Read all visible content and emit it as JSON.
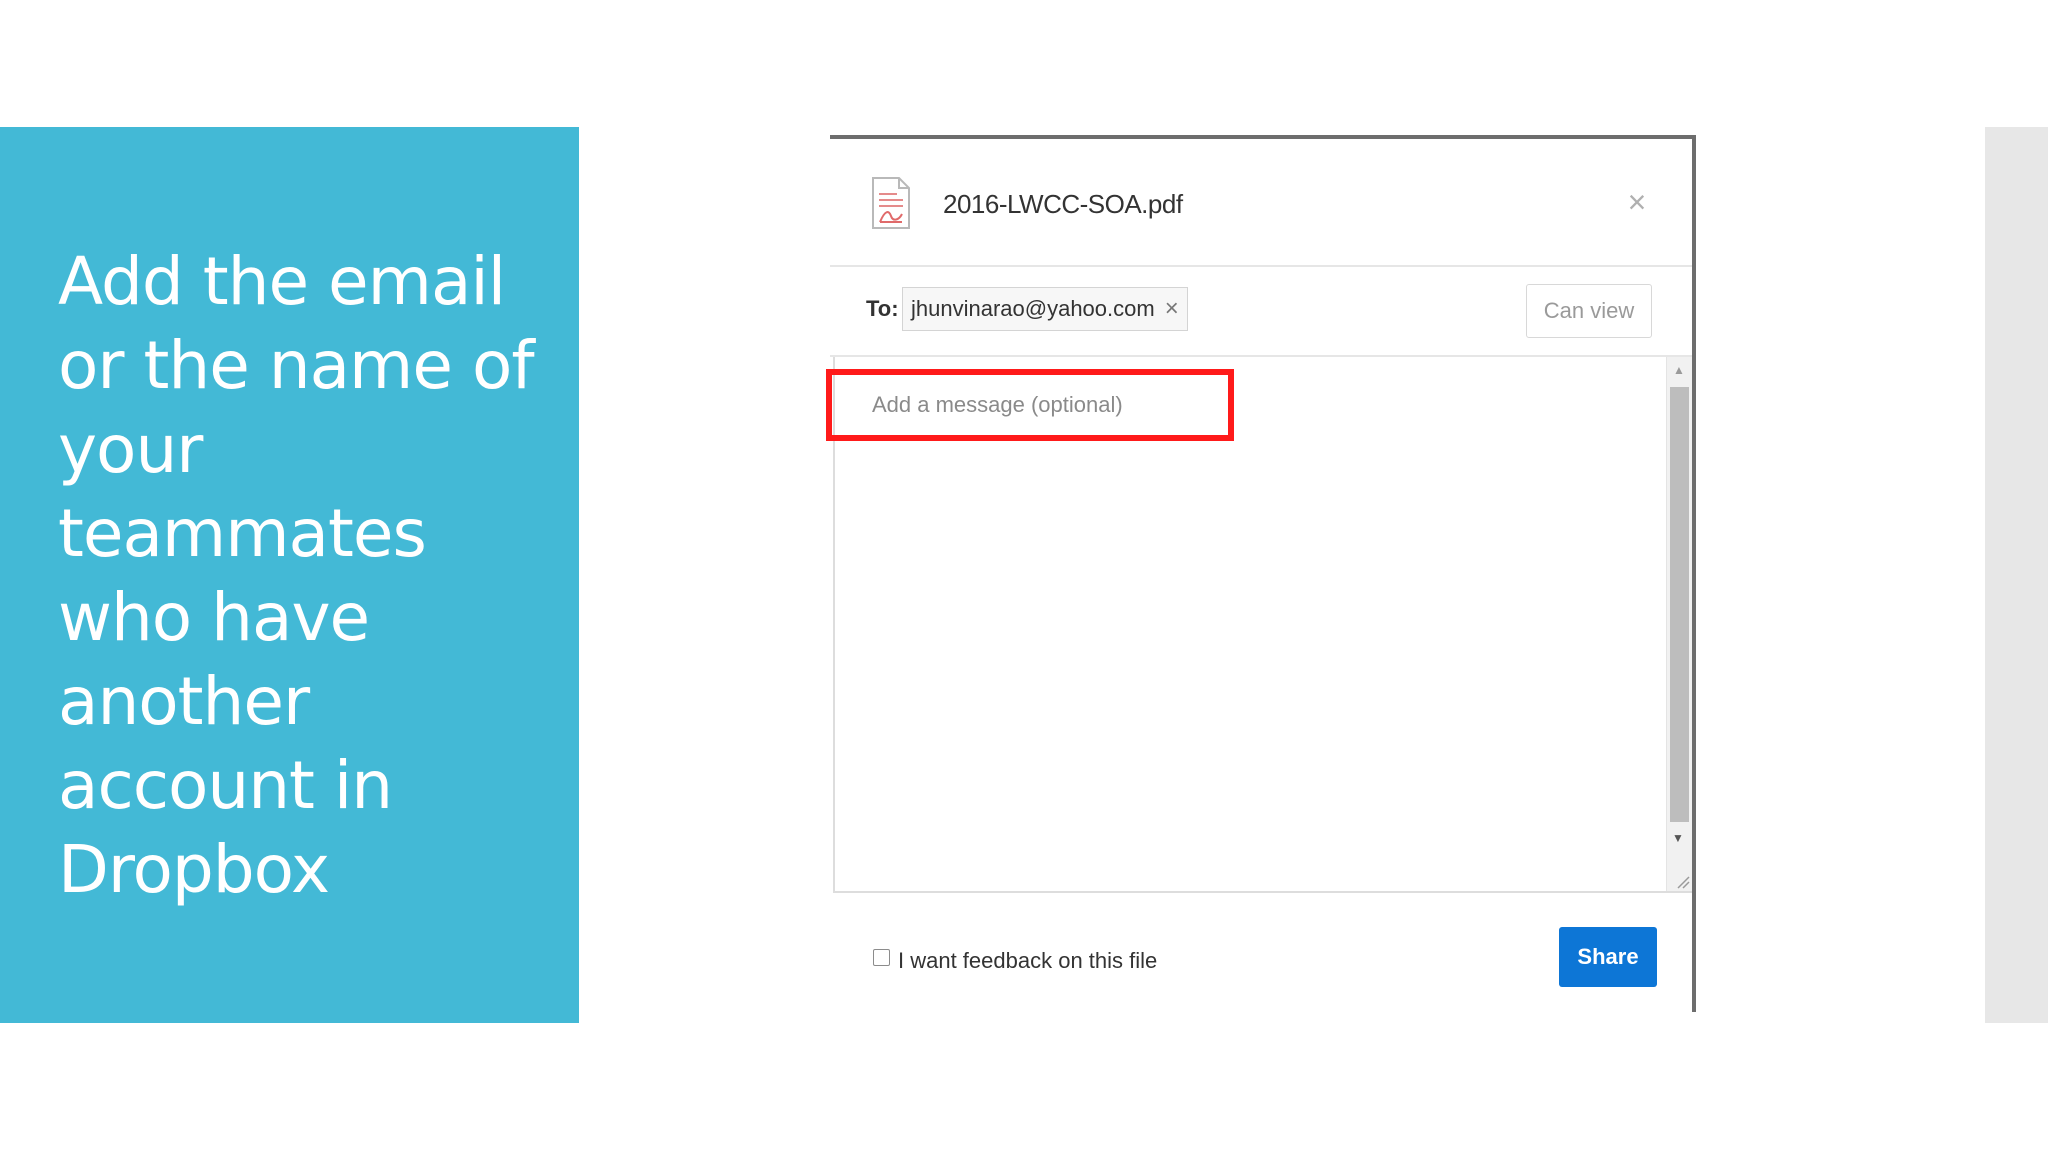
{
  "slide": {
    "title": "Add the email or the name of your teammates who have another account in Dropbox"
  },
  "dialog": {
    "file_name": "2016-LWCC-SOA.pdf",
    "file_icon": "pdf-file-icon",
    "close_glyph": "×",
    "to_label": "To:",
    "recipient_email": "jhunvinarao@yahoo.com",
    "chip_remove_glyph": "×",
    "permission_label": "Can view",
    "message_placeholder": "Add a message (optional)",
    "feedback_label": "I want feedback on this file",
    "feedback_checked": false,
    "share_label": "Share"
  },
  "colors": {
    "panel": "#43b9d6",
    "share_button": "#0d76d6",
    "highlight": "#ff1a1a"
  }
}
